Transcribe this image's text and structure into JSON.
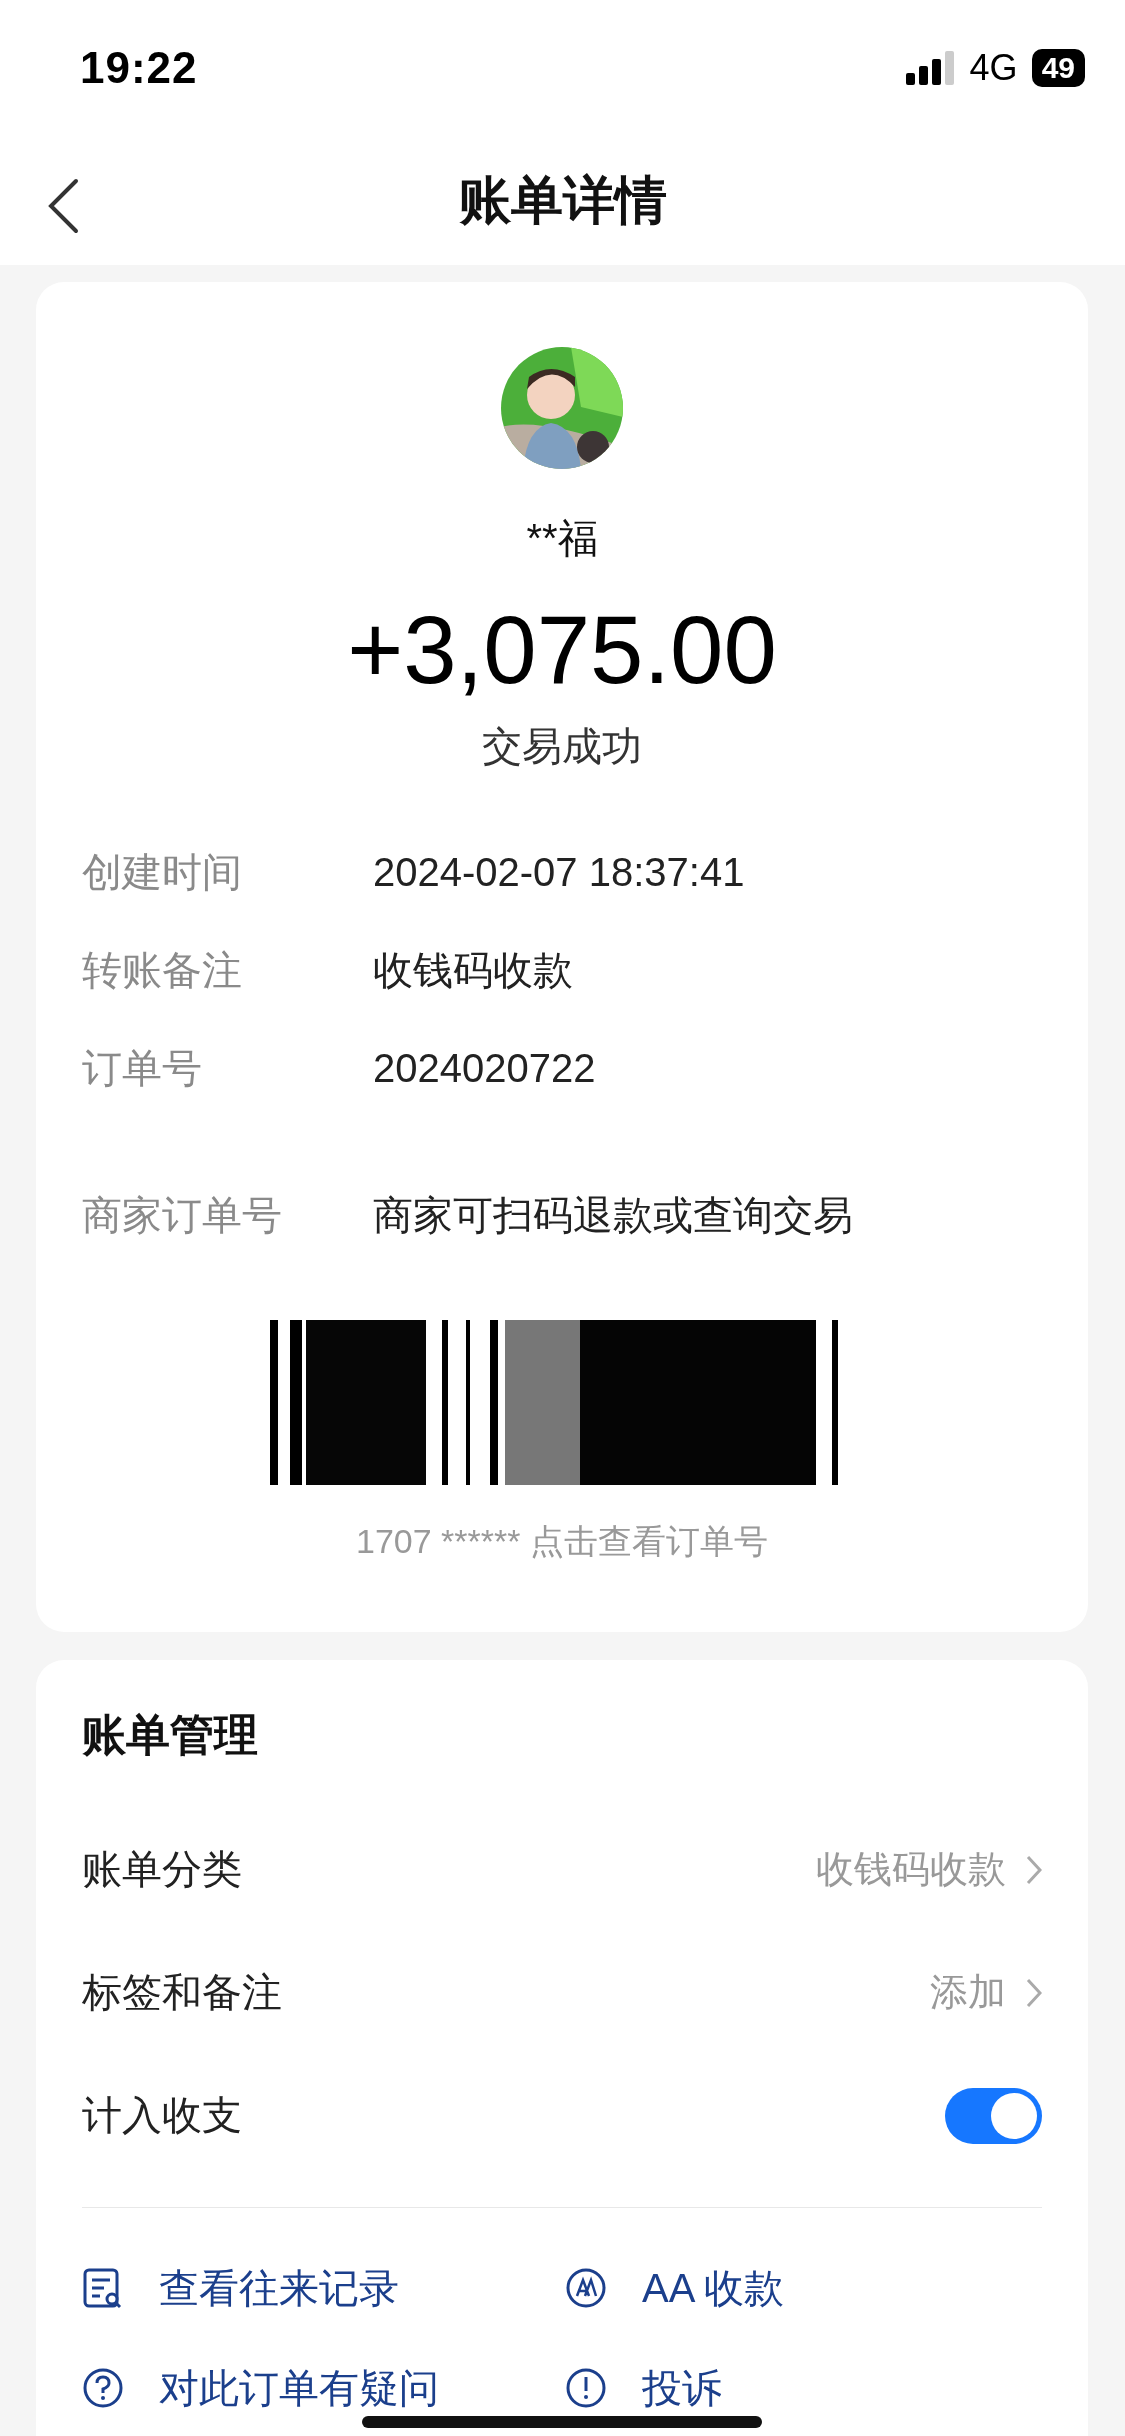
{
  "status_bar": {
    "time": "19:22",
    "network": "4G",
    "battery": "49"
  },
  "nav": {
    "title": "账单详情"
  },
  "payer": {
    "name": "**福",
    "amount": "+3,075.00",
    "status": "交易成功"
  },
  "details": [
    {
      "label": "创建时间",
      "value": "2024-02-07 18:37:41"
    },
    {
      "label": "转账备注",
      "value": "收钱码收款"
    },
    {
      "label": "订单号",
      "value": "2024020722"
    },
    {
      "label": "商家订单号",
      "value": "商家可扫码退款或查询交易"
    }
  ],
  "barcode": {
    "caption": "1707 ****** 点击查看订单号"
  },
  "management": {
    "title": "账单管理",
    "rows": [
      {
        "kind": "link",
        "label": "账单分类",
        "value": "收钱码收款"
      },
      {
        "kind": "link",
        "label": "标签和备注",
        "value": "添加"
      },
      {
        "kind": "toggle",
        "label": "计入收支",
        "on": true
      }
    ]
  },
  "actions": [
    {
      "kind": "records",
      "label": "查看往来记录"
    },
    {
      "kind": "aa",
      "label": "AA 收款"
    },
    {
      "kind": "question",
      "label": "对此订单有疑问"
    },
    {
      "kind": "alert",
      "label": "投诉"
    }
  ]
}
